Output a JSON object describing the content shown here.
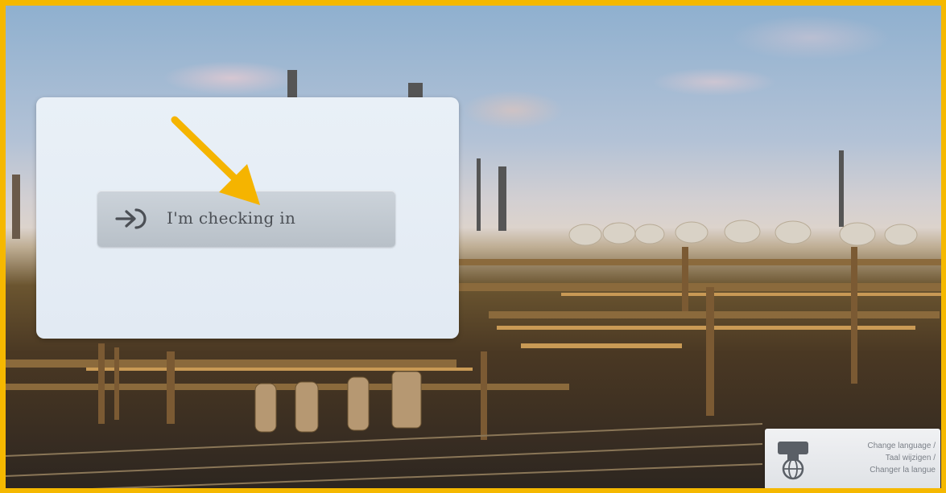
{
  "checkin": {
    "label": "I'm checking in"
  },
  "language": {
    "label": "Change language /\nTaal wijzigen /\nChanger la langue"
  },
  "colors": {
    "frame": "#f5b800",
    "arrow": "#f5b400",
    "panel": "#e6edf5"
  },
  "icons": [
    "sign-in-arrow-icon",
    "globe-flag-icon",
    "annotation-arrow"
  ]
}
